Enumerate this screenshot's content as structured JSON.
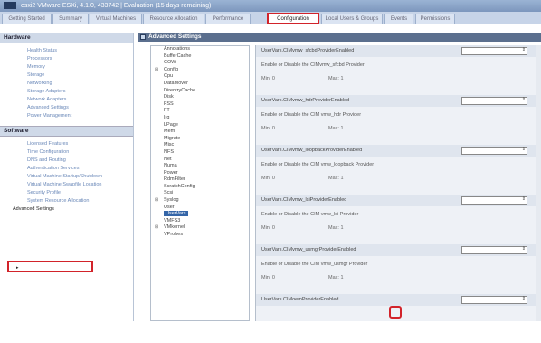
{
  "window": {
    "title": "esxi2 VMware ESXi, 4.1.0, 433742 | Evaluation (15 days remaining)"
  },
  "tabs": [
    {
      "label": "Getting Started"
    },
    {
      "label": "Summary"
    },
    {
      "label": "Virtual Machines"
    },
    {
      "label": "Resource Allocation"
    },
    {
      "label": "Performance"
    },
    {
      "label": "Configuration"
    },
    {
      "label": "Local Users & Groups"
    },
    {
      "label": "Events"
    },
    {
      "label": "Permissions"
    }
  ],
  "hardware": {
    "heading": "Hardware",
    "items": [
      "Health Status",
      "Processors",
      "Memory",
      "Storage",
      "Networking",
      "Storage Adapters",
      "Network Adapters",
      "Advanced Settings",
      "Power Management"
    ]
  },
  "software": {
    "heading": "Software",
    "items": [
      "Licensed Features",
      "Time Configuration",
      "DNS and Routing",
      "Authentication Services",
      "Virtual Machine Startup/Shutdown",
      "Virtual Machine Swapfile Location",
      "Security Profile",
      "System Resource Allocation",
      "Advanced Settings"
    ]
  },
  "advanced": {
    "heading": "Advanced Settings",
    "tree": [
      "Annotations",
      "BufferCache",
      "COW",
      "Config",
      "Cpu",
      "DataMover",
      "DirentryCache",
      "Disk",
      "FSS",
      "FT",
      "Irq",
      "LPage",
      "Mem",
      "Migrate",
      "Misc",
      "NFS",
      "Net",
      "Numa",
      "Power",
      "RdmFilter",
      "ScratchConfig",
      "Scsi",
      "Syslog",
      "User",
      "UserVars",
      "VMFS3",
      "VMkernel",
      "VProbes"
    ],
    "selected": "UserVars",
    "settings": [
      {
        "name": "UserVars.CIMvmw_sfcbdProviderEnabled",
        "description": "Enable or Disable the CIMvmw_sfcbd Provider",
        "min": "Min: 0",
        "max": "Max: 1"
      },
      {
        "name": "UserVars.CIMvmw_hdrProviderEnabled",
        "description": "Enable or Disable the CIM vmw_hdr Provider",
        "min": "Min: 0",
        "max": "Max: 1"
      },
      {
        "name": "UserVars.CIMvmw_loopbackProviderEnabled",
        "description": "Enable or Disable the CIM vmw_loopback Provider",
        "min": "Min: 0",
        "max": "Max: 1"
      },
      {
        "name": "UserVars.CIMvmw_lsiProviderEnabled",
        "description": "Enable or Disable the CIM vmw_lsi Provider",
        "min": "Min: 0",
        "max": "Max: 1"
      },
      {
        "name": "UserVars.CIMvmw_usmgrProviderEnabled",
        "description": "Enable or Disable the CIM vmw_usmgr Provider",
        "min": "Min: 0",
        "max": "Max: 1"
      },
      {
        "name": "UserVars.CIMoemProviderEnabled",
        "description": "",
        "min": "",
        "max": ""
      }
    ]
  },
  "colors": {
    "highlight": "#d2232a",
    "header": "#5b6f8e"
  }
}
